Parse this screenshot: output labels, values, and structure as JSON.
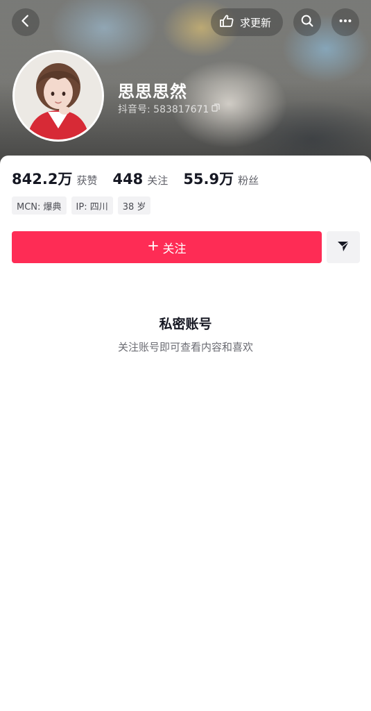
{
  "header": {
    "update_label": "求更新",
    "icons": {
      "back": "chevron-left-icon",
      "update": "hand-point-icon",
      "search": "search-icon",
      "more": "more-dots-icon"
    }
  },
  "profile": {
    "name": "思思思然",
    "id_label": "抖音号: 583817671",
    "avatar": "avatar-photo"
  },
  "stats": [
    {
      "value": "842.2万",
      "label": "获赞"
    },
    {
      "value": "448",
      "label": "关注"
    },
    {
      "value": "55.9万",
      "label": "粉丝"
    }
  ],
  "tags": [
    "MCN: 爆典",
    "IP: 四川",
    "38 岁"
  ],
  "actions": {
    "follow_label": "关注",
    "follow_icon": "plus-icon",
    "share_icon": "send-icon"
  },
  "private": {
    "title": "私密账号",
    "subtitle": "关注账号即可查看内容和喜欢"
  },
  "colors": {
    "accent": "#fe2c55",
    "text_primary": "#161823",
    "text_secondary": "#6b6c73",
    "tag_bg": "#f2f2f4"
  }
}
